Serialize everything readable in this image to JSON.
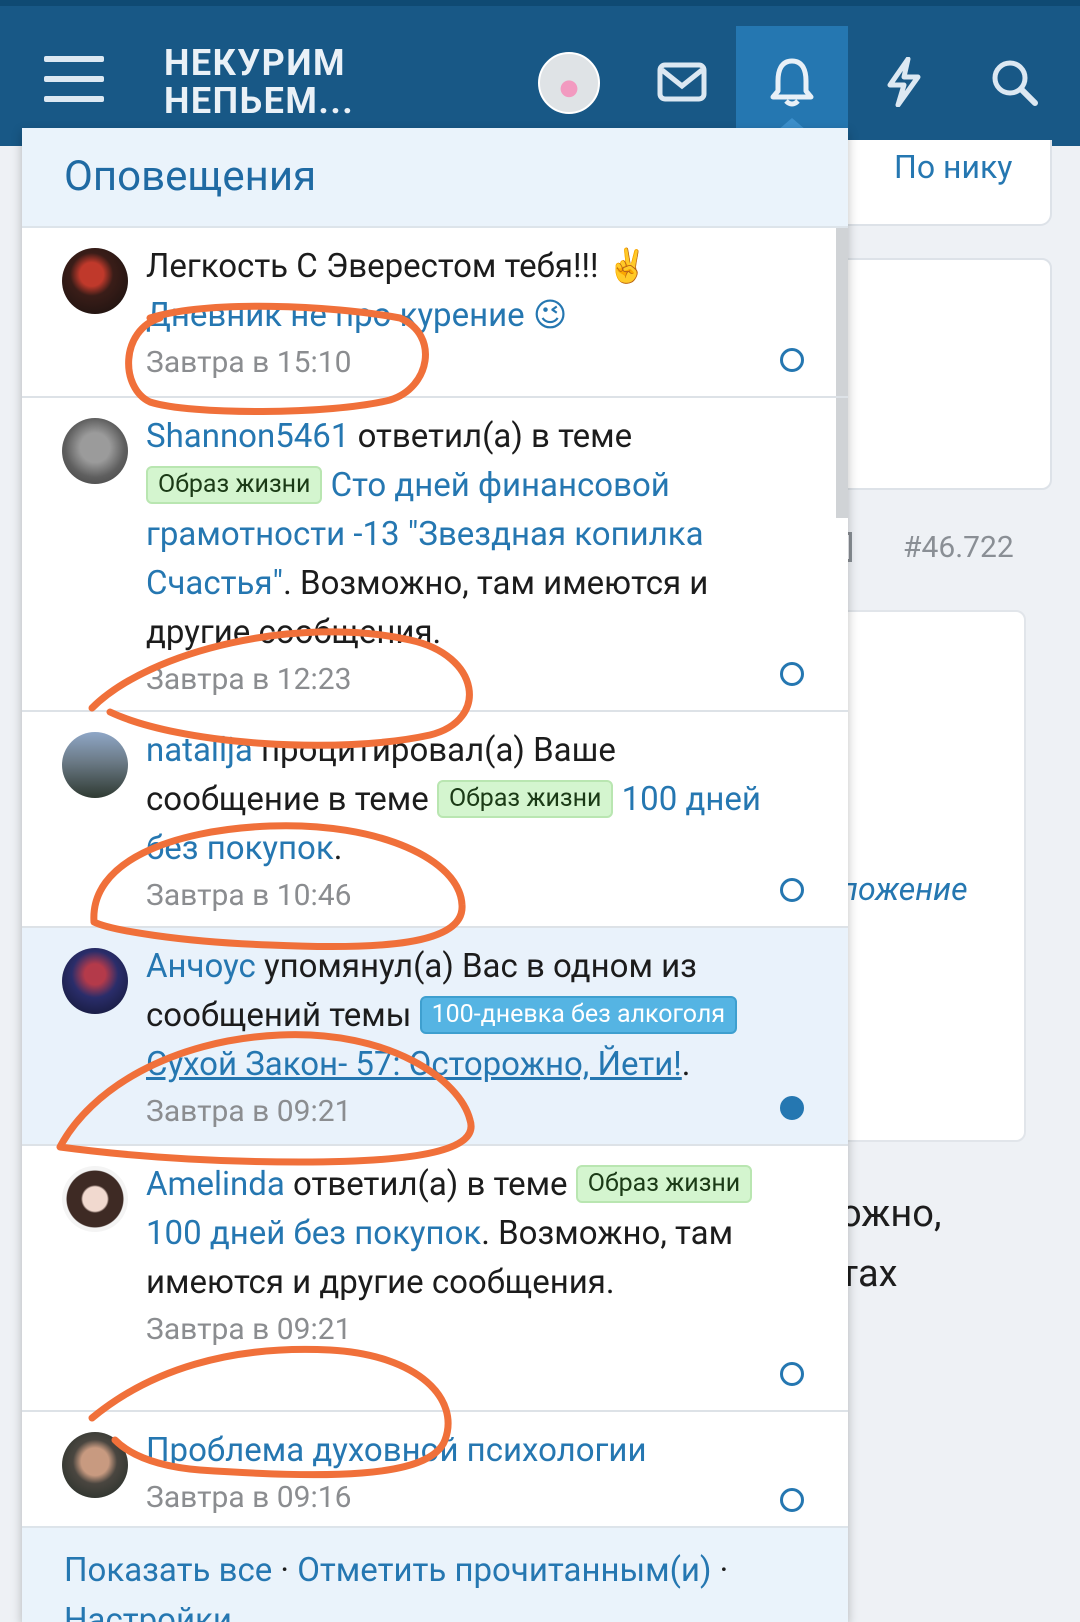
{
  "header": {
    "logo_line1": "НЕКУРИМ",
    "logo_line2": "НЕПЬЕМ...",
    "icons": [
      "menu-icon",
      "avatar",
      "mail-icon",
      "bell-icon",
      "bolt-icon",
      "search-icon"
    ]
  },
  "background": {
    "by_nick": "По нику",
    "post_number": "#46.722",
    "italic_fragment": "ложение",
    "text_fragment1": "ожно,",
    "text_fragment2": "тах"
  },
  "panel": {
    "title": "Оповещения",
    "items": [
      {
        "text": "Легкость С Эверестом тебя!!! ✌️",
        "link": "Дневник не про курение 😉",
        "time": "Завтра в 15:10",
        "read": true
      },
      {
        "user": "Shannon5461",
        "action": " ответил(а) в теме ",
        "prefix": "Образ жизни",
        "thread": "Сто дней финансовой грамотности -13 \"Звездная копилка Счастья\"",
        "suffix": ". Возможно, там имеются и другие сообщения.",
        "time": "Завтра в 12:23",
        "read": true
      },
      {
        "user": "natallja",
        "action": " процитировал(а) Ваше сообщение в теме ",
        "prefix": "Образ жизни",
        "thread": "100 дней без покупок",
        "suffix": ".",
        "time": "Завтра в 10:46",
        "read": true
      },
      {
        "user": "Анчоус",
        "action": " упомянул(а) Вас в одном из сообщений темы ",
        "prefix": "100-дневка без алкоголя",
        "thread": "Сухой Закон- 57: Осторожно, Йети!",
        "suffix": ".",
        "time": "Завтра в 09:21",
        "read": false
      },
      {
        "user": "Amelinda",
        "action": " ответил(а) в теме ",
        "prefix": "Образ жизни",
        "thread": "100 дней без покупок",
        "suffix": ". Возможно, там имеются и другие сообщения.",
        "time": "Завтра в 09:21",
        "read": true
      },
      {
        "link": "Проблема духовной психологии",
        "time": "Завтра в 09:16",
        "read": true
      }
    ],
    "footer": {
      "show_all": "Показать все",
      "sep": " · ",
      "mark_read": "Отметить прочитанным(и)",
      "settings": "Настройки"
    }
  },
  "colors": {
    "header_bg": "#185886",
    "accent": "#2577b1",
    "annotation": "#f0703a"
  }
}
